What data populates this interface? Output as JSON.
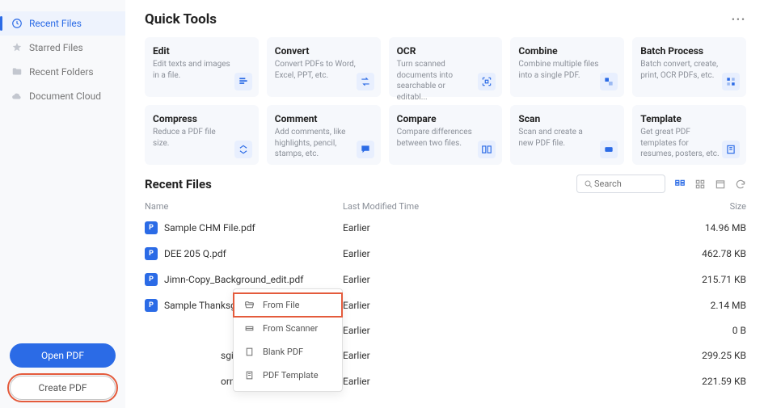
{
  "sidebar": {
    "items": [
      {
        "label": "Recent Files"
      },
      {
        "label": "Starred Files"
      },
      {
        "label": "Recent Folders"
      },
      {
        "label": "Document Cloud"
      }
    ],
    "open_btn": "Open PDF",
    "create_btn": "Create PDF"
  },
  "header": {
    "title": "Quick Tools"
  },
  "tools": [
    {
      "title": "Edit",
      "desc": "Edit texts and images in a file."
    },
    {
      "title": "Convert",
      "desc": "Convert PDFs to Word, Excel, PPT, etc."
    },
    {
      "title": "OCR",
      "desc": "Turn scanned documents into searchable or editabl..."
    },
    {
      "title": "Combine",
      "desc": "Combine multiple files into a single PDF."
    },
    {
      "title": "Batch Process",
      "desc": "Batch convert, create, print, OCR PDFs, etc."
    },
    {
      "title": "Compress",
      "desc": "Reduce a PDF file size."
    },
    {
      "title": "Comment",
      "desc": "Add comments, like highlights, pencil, stamps, etc."
    },
    {
      "title": "Compare",
      "desc": "Compare differences between two files."
    },
    {
      "title": "Scan",
      "desc": "Scan and create a new PDF file."
    },
    {
      "title": "Template",
      "desc": "Get great PDF templates for resumes, posters, etc."
    }
  ],
  "recent": {
    "title": "Recent Files",
    "search_placeholder": "Search",
    "cols": {
      "name": "Name",
      "time": "Last Modified Time",
      "size": "Size"
    },
    "rows": [
      {
        "name": "Sample CHM File.pdf",
        "time": "Earlier",
        "size": "14.96 MB"
      },
      {
        "name": "DEE 205 Q.pdf",
        "time": "Earlier",
        "size": "462.78 KB"
      },
      {
        "name": "Jimn-Copy_Background_edit.pdf",
        "time": "Earlier",
        "size": "215.71 KB"
      },
      {
        "name": "Sample Thanksgiving Card Template.pdf",
        "time": "Earlier",
        "size": "2.14 MB"
      },
      {
        "name": "",
        "time": "Earlier",
        "size": "0 B"
      },
      {
        "name": "sgiving Day.pdf",
        "time": "Earlier",
        "size": "299.25 KB"
      },
      {
        "name": "orm.pdf",
        "time": "Earlier",
        "size": "221.59 KB"
      }
    ]
  },
  "popup": {
    "items": [
      {
        "label": "From File"
      },
      {
        "label": "From Scanner"
      },
      {
        "label": "Blank PDF"
      },
      {
        "label": "PDF Template"
      }
    ]
  }
}
